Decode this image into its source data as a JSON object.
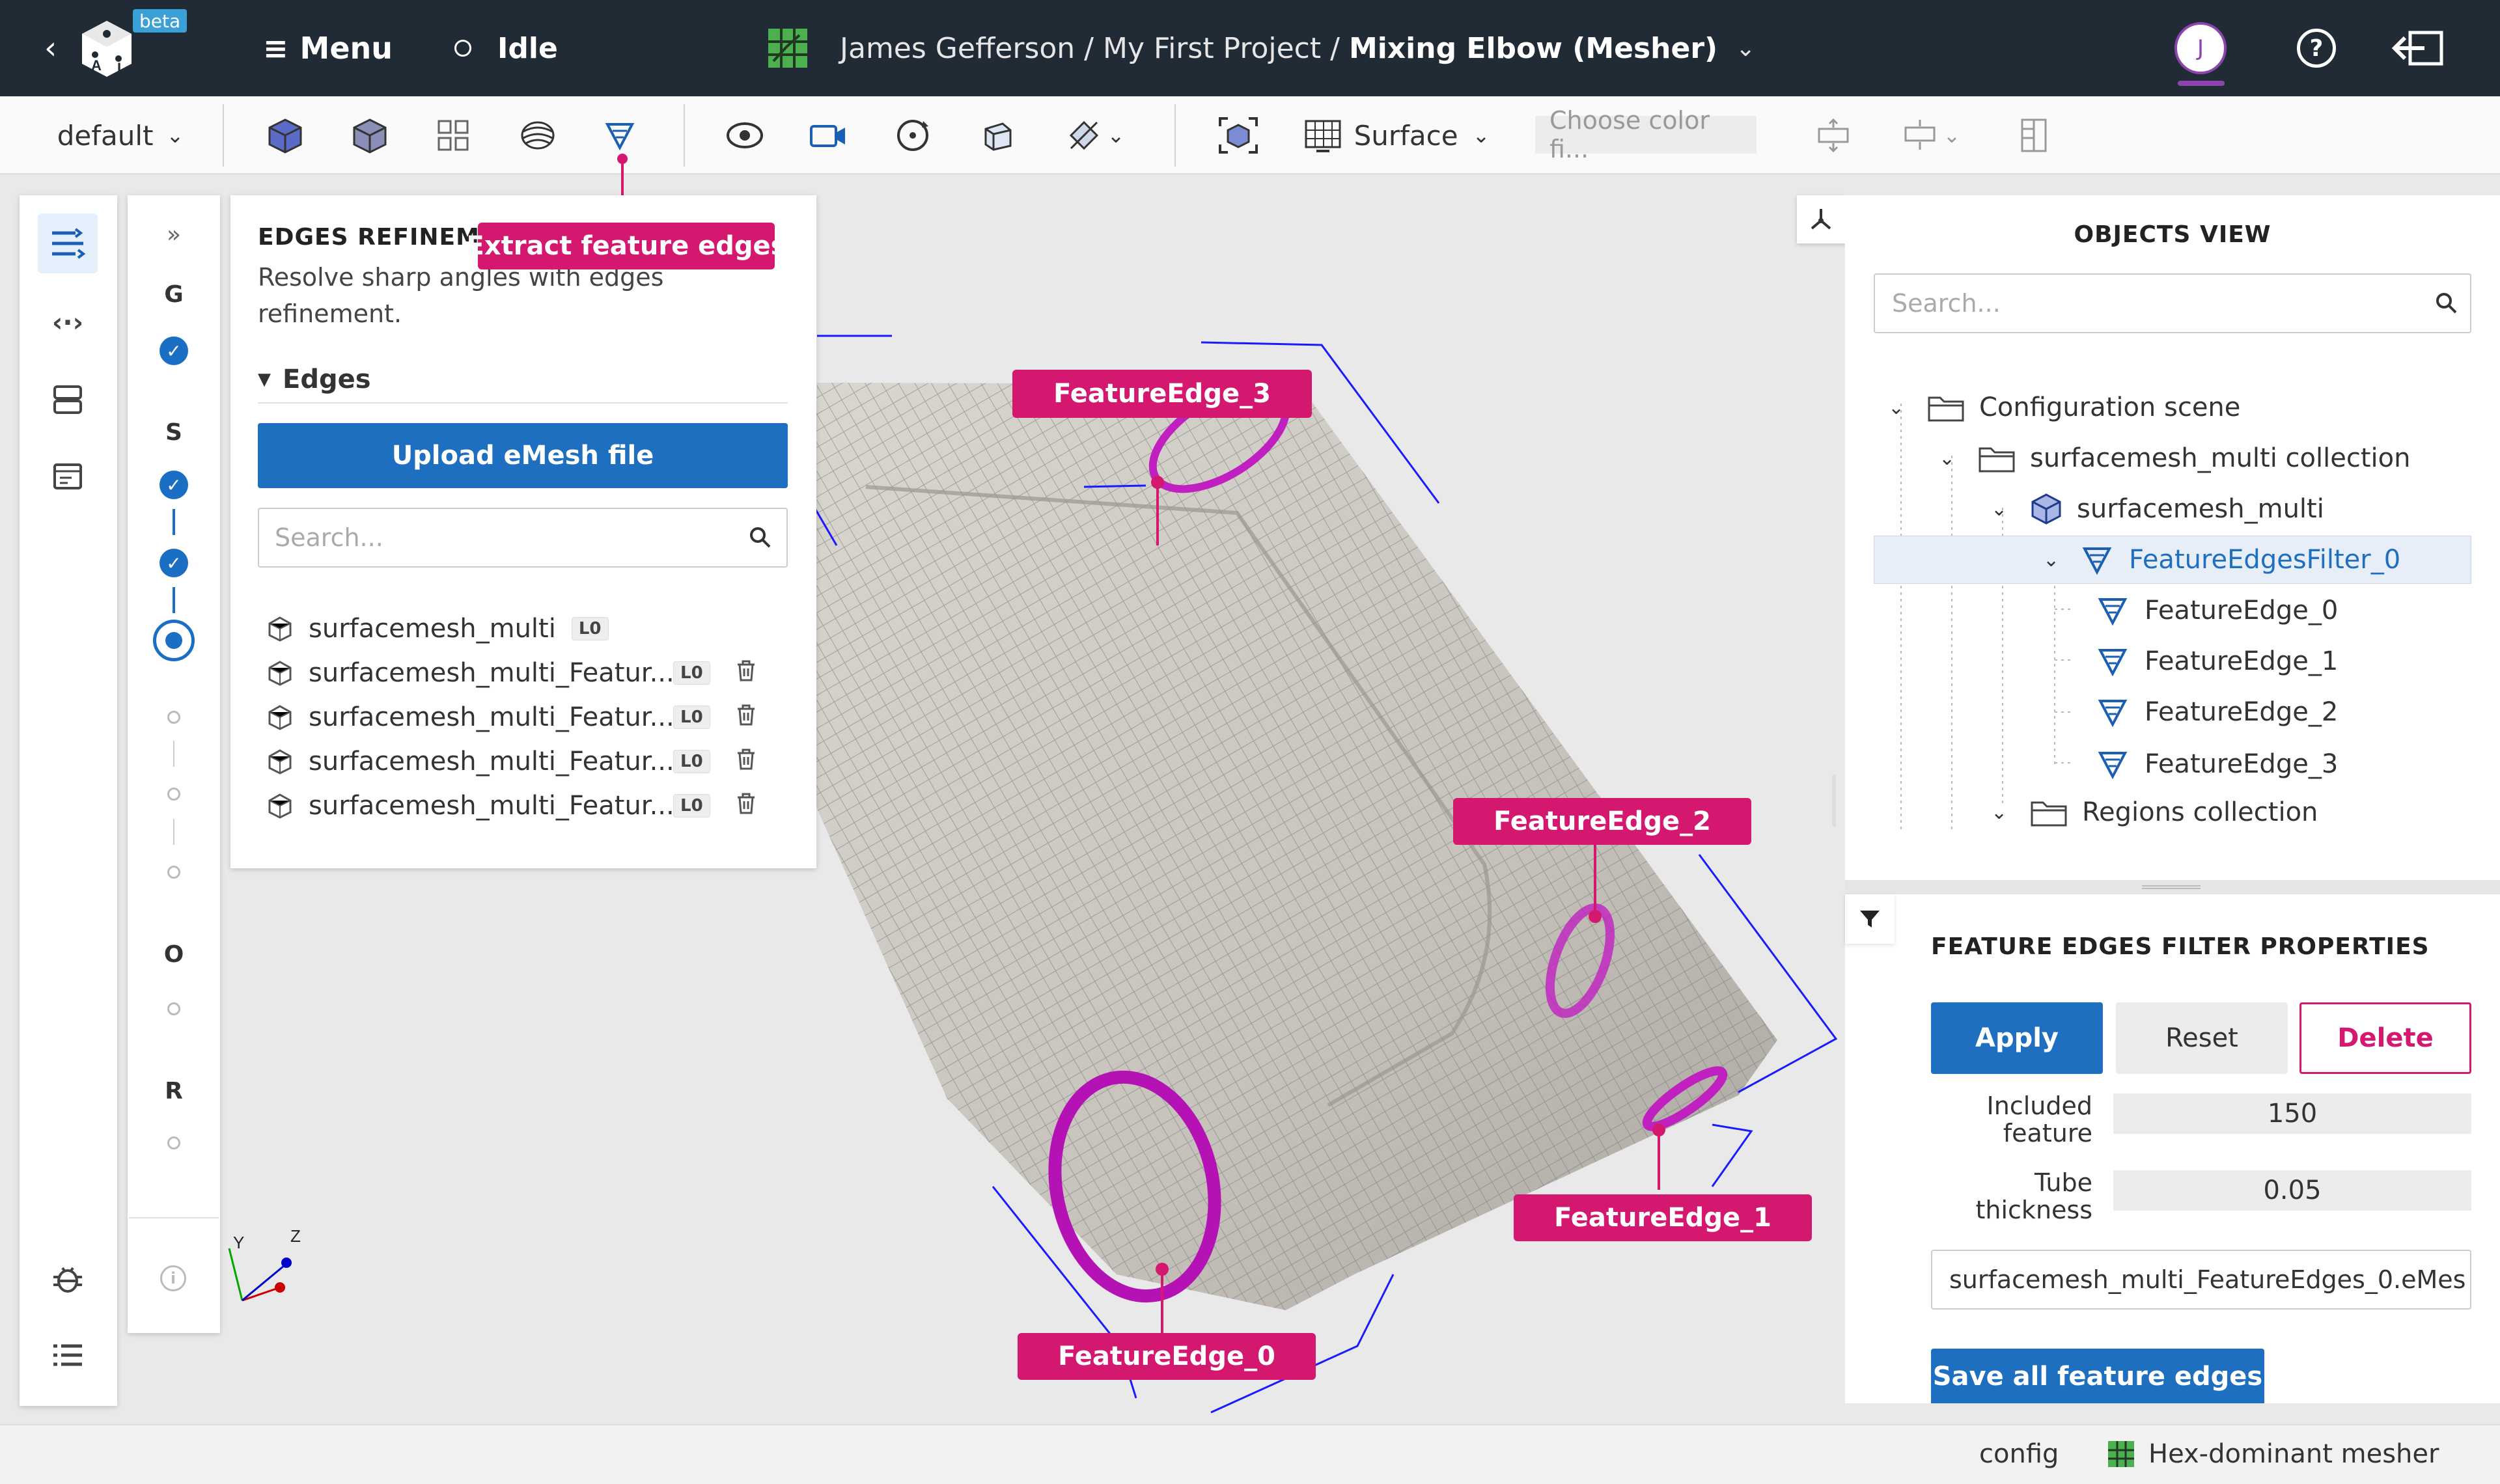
{
  "header": {
    "beta_badge": "beta",
    "menu_label": "Menu",
    "status": "Idle",
    "breadcrumb_user": "James Gefferson",
    "breadcrumb_sep1": "/",
    "breadcrumb_project": "My First Project",
    "breadcrumb_sep2": "/",
    "breadcrumb_current": "Mixing Elbow (Mesher)",
    "avatar_initial": "J"
  },
  "toolbar": {
    "preset": "default",
    "representation": "Surface",
    "color_placeholder": "Choose color fi...",
    "tooltip": "Extract feature edges"
  },
  "steps": {
    "g": "G",
    "s": "S",
    "o": "O",
    "r": "R",
    "expand": "»"
  },
  "edges_panel": {
    "title": "EDGES REFINEMENT",
    "description": "Resolve sharp angles with edges refinement.",
    "section": "Edges",
    "upload_label": "Upload eMesh file",
    "search_placeholder": "Search...",
    "items": [
      {
        "name": "surfacemesh_multi",
        "badge": "L0"
      },
      {
        "name": "surfacemesh_multi_Featur...",
        "badge": "L0"
      },
      {
        "name": "surfacemesh_multi_Featur...",
        "badge": "L0"
      },
      {
        "name": "surfacemesh_multi_Featur...",
        "badge": "L0"
      },
      {
        "name": "surfacemesh_multi_Featur...",
        "badge": "L0"
      }
    ]
  },
  "viewport": {
    "labels": [
      "FeatureEdge_3",
      "FeatureEdge_2",
      "FeatureEdge_1",
      "FeatureEdge_0"
    ],
    "axes": {
      "y": "Y",
      "z": "Z"
    },
    "accent": "#d5186f",
    "edge_color": "#c020c0",
    "bbox_color": "#1a1aff"
  },
  "objects_view": {
    "title": "OBJECTS VIEW",
    "search_placeholder": "Search...",
    "tree": [
      {
        "label": "Configuration scene",
        "level": 0,
        "icon": "folder-icon"
      },
      {
        "label": "surfacemesh_multi collection",
        "level": 1,
        "icon": "folder-icon"
      },
      {
        "label": "surfacemesh_multi",
        "level": 2,
        "icon": "mesh-icon"
      },
      {
        "label": "FeatureEdgesFilter_0",
        "level": 3,
        "icon": "filter-icon",
        "selected": true
      },
      {
        "label": "FeatureEdge_0",
        "level": 4,
        "icon": "filter-icon"
      },
      {
        "label": "FeatureEdge_1",
        "level": 4,
        "icon": "filter-icon"
      },
      {
        "label": "FeatureEdge_2",
        "level": 4,
        "icon": "filter-icon"
      },
      {
        "label": "FeatureEdge_3",
        "level": 4,
        "icon": "filter-icon"
      },
      {
        "label": "Regions collection",
        "level": 2,
        "icon": "folder-icon"
      }
    ]
  },
  "properties": {
    "title": "FEATURE EDGES FILTER PROPERTIES",
    "apply": "Apply",
    "reset": "Reset",
    "delete": "Delete",
    "included_label_1": "Included",
    "included_label_2": "feature",
    "included_value": "150",
    "tube_label_1": "Tube",
    "tube_label_2": "thickness",
    "tube_value": "0.05",
    "file_value": "surfacemesh_multi_FeatureEdges_0.eMes",
    "save_label": "Save all feature edges"
  },
  "statusbar": {
    "config": "config",
    "mesher": "Hex-dominant mesher"
  }
}
